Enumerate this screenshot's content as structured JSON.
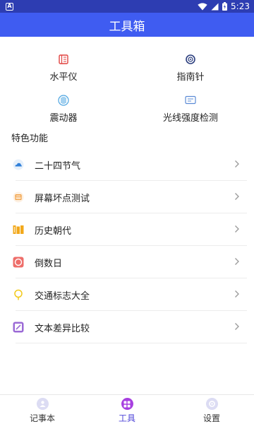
{
  "status": {
    "time": "5:23",
    "left_icon": "android-a-icon"
  },
  "header": {
    "title": "工具箱"
  },
  "tools": [
    {
      "label": "水平仪",
      "icon": "level-icon",
      "color": "#e0423f"
    },
    {
      "label": "指南针",
      "icon": "compass-icon",
      "color": "#2b3e7e"
    },
    {
      "label": "震动器",
      "icon": "vibrator-icon",
      "color": "#4aa3e0"
    },
    {
      "label": "光线强度检测",
      "icon": "light-meter-icon",
      "color": "#5b8bd6"
    }
  ],
  "section": {
    "title": "特色功能"
  },
  "features": [
    {
      "label": "二十四节气",
      "icon": "solar-terms-icon",
      "color": "#2f7fd9"
    },
    {
      "label": "屏幕坏点测试",
      "icon": "screen-test-icon",
      "color": "#f0962e"
    },
    {
      "label": "历史朝代",
      "icon": "history-dynasty-icon",
      "color": "#f2a81b"
    },
    {
      "label": "倒数日",
      "icon": "countdown-icon",
      "color": "#ee6e6a"
    },
    {
      "label": "交通标志大全",
      "icon": "traffic-sign-icon",
      "color": "#f2c91b"
    },
    {
      "label": "文本差异比较",
      "icon": "text-diff-icon",
      "color": "#9b6ad6"
    }
  ],
  "nav": [
    {
      "label": "记事本",
      "icon": "notebook-icon"
    },
    {
      "label": "工具",
      "icon": "tools-icon",
      "active": true
    },
    {
      "label": "设置",
      "icon": "settings-icon"
    }
  ],
  "colors": {
    "statusbar": "#2d3db2",
    "appbar": "#3f5cf1",
    "active": "#4e45d8"
  }
}
